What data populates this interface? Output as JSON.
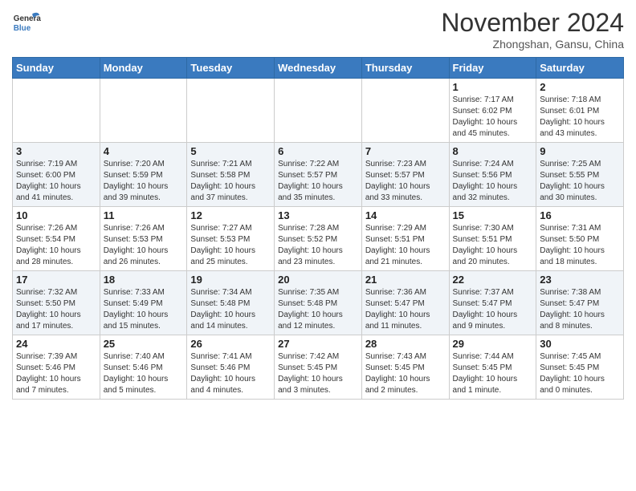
{
  "header": {
    "logo_line1": "General",
    "logo_line2": "Blue",
    "month": "November 2024",
    "location": "Zhongshan, Gansu, China"
  },
  "weekdays": [
    "Sunday",
    "Monday",
    "Tuesday",
    "Wednesday",
    "Thursday",
    "Friday",
    "Saturday"
  ],
  "weeks": [
    [
      {
        "day": "",
        "info": ""
      },
      {
        "day": "",
        "info": ""
      },
      {
        "day": "",
        "info": ""
      },
      {
        "day": "",
        "info": ""
      },
      {
        "day": "",
        "info": ""
      },
      {
        "day": "1",
        "info": "Sunrise: 7:17 AM\nSunset: 6:02 PM\nDaylight: 10 hours\nand 45 minutes."
      },
      {
        "day": "2",
        "info": "Sunrise: 7:18 AM\nSunset: 6:01 PM\nDaylight: 10 hours\nand 43 minutes."
      }
    ],
    [
      {
        "day": "3",
        "info": "Sunrise: 7:19 AM\nSunset: 6:00 PM\nDaylight: 10 hours\nand 41 minutes."
      },
      {
        "day": "4",
        "info": "Sunrise: 7:20 AM\nSunset: 5:59 PM\nDaylight: 10 hours\nand 39 minutes."
      },
      {
        "day": "5",
        "info": "Sunrise: 7:21 AM\nSunset: 5:58 PM\nDaylight: 10 hours\nand 37 minutes."
      },
      {
        "day": "6",
        "info": "Sunrise: 7:22 AM\nSunset: 5:57 PM\nDaylight: 10 hours\nand 35 minutes."
      },
      {
        "day": "7",
        "info": "Sunrise: 7:23 AM\nSunset: 5:57 PM\nDaylight: 10 hours\nand 33 minutes."
      },
      {
        "day": "8",
        "info": "Sunrise: 7:24 AM\nSunset: 5:56 PM\nDaylight: 10 hours\nand 32 minutes."
      },
      {
        "day": "9",
        "info": "Sunrise: 7:25 AM\nSunset: 5:55 PM\nDaylight: 10 hours\nand 30 minutes."
      }
    ],
    [
      {
        "day": "10",
        "info": "Sunrise: 7:26 AM\nSunset: 5:54 PM\nDaylight: 10 hours\nand 28 minutes."
      },
      {
        "day": "11",
        "info": "Sunrise: 7:26 AM\nSunset: 5:53 PM\nDaylight: 10 hours\nand 26 minutes."
      },
      {
        "day": "12",
        "info": "Sunrise: 7:27 AM\nSunset: 5:53 PM\nDaylight: 10 hours\nand 25 minutes."
      },
      {
        "day": "13",
        "info": "Sunrise: 7:28 AM\nSunset: 5:52 PM\nDaylight: 10 hours\nand 23 minutes."
      },
      {
        "day": "14",
        "info": "Sunrise: 7:29 AM\nSunset: 5:51 PM\nDaylight: 10 hours\nand 21 minutes."
      },
      {
        "day": "15",
        "info": "Sunrise: 7:30 AM\nSunset: 5:51 PM\nDaylight: 10 hours\nand 20 minutes."
      },
      {
        "day": "16",
        "info": "Sunrise: 7:31 AM\nSunset: 5:50 PM\nDaylight: 10 hours\nand 18 minutes."
      }
    ],
    [
      {
        "day": "17",
        "info": "Sunrise: 7:32 AM\nSunset: 5:50 PM\nDaylight: 10 hours\nand 17 minutes."
      },
      {
        "day": "18",
        "info": "Sunrise: 7:33 AM\nSunset: 5:49 PM\nDaylight: 10 hours\nand 15 minutes."
      },
      {
        "day": "19",
        "info": "Sunrise: 7:34 AM\nSunset: 5:48 PM\nDaylight: 10 hours\nand 14 minutes."
      },
      {
        "day": "20",
        "info": "Sunrise: 7:35 AM\nSunset: 5:48 PM\nDaylight: 10 hours\nand 12 minutes."
      },
      {
        "day": "21",
        "info": "Sunrise: 7:36 AM\nSunset: 5:47 PM\nDaylight: 10 hours\nand 11 minutes."
      },
      {
        "day": "22",
        "info": "Sunrise: 7:37 AM\nSunset: 5:47 PM\nDaylight: 10 hours\nand 9 minutes."
      },
      {
        "day": "23",
        "info": "Sunrise: 7:38 AM\nSunset: 5:47 PM\nDaylight: 10 hours\nand 8 minutes."
      }
    ],
    [
      {
        "day": "24",
        "info": "Sunrise: 7:39 AM\nSunset: 5:46 PM\nDaylight: 10 hours\nand 7 minutes."
      },
      {
        "day": "25",
        "info": "Sunrise: 7:40 AM\nSunset: 5:46 PM\nDaylight: 10 hours\nand 5 minutes."
      },
      {
        "day": "26",
        "info": "Sunrise: 7:41 AM\nSunset: 5:46 PM\nDaylight: 10 hours\nand 4 minutes."
      },
      {
        "day": "27",
        "info": "Sunrise: 7:42 AM\nSunset: 5:45 PM\nDaylight: 10 hours\nand 3 minutes."
      },
      {
        "day": "28",
        "info": "Sunrise: 7:43 AM\nSunset: 5:45 PM\nDaylight: 10 hours\nand 2 minutes."
      },
      {
        "day": "29",
        "info": "Sunrise: 7:44 AM\nSunset: 5:45 PM\nDaylight: 10 hours\nand 1 minute."
      },
      {
        "day": "30",
        "info": "Sunrise: 7:45 AM\nSunset: 5:45 PM\nDaylight: 10 hours\nand 0 minutes."
      }
    ]
  ]
}
